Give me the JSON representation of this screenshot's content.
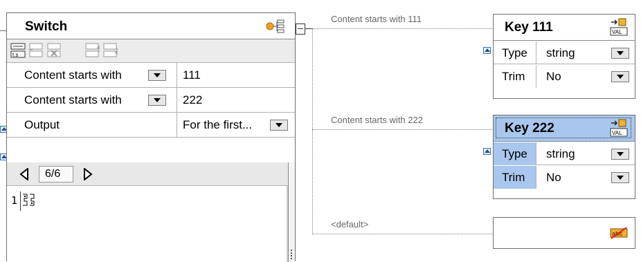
{
  "switch": {
    "title": "Switch",
    "conditions": [
      {
        "operator": "Content starts with",
        "value": "111"
      },
      {
        "operator": "Content starts with",
        "value": "222"
      }
    ],
    "output": {
      "label": "Output",
      "value": "For the first..."
    },
    "pager": {
      "text": "6/6"
    },
    "editor": {
      "line_number": "1"
    }
  },
  "connections": {
    "label_111": "Content starts with 111",
    "label_222": "Content starts with 222",
    "label_default": "<default>"
  },
  "keys": [
    {
      "title": "Key 111",
      "type_label": "Type",
      "type_value": "string",
      "trim_label": "Trim",
      "trim_value": "No"
    },
    {
      "title": "Key 222",
      "type_label": "Type",
      "type_value": "string",
      "trim_label": "Trim",
      "trim_value": "No"
    }
  ],
  "colors": {
    "selection": "#a9c7ee",
    "accent": "#f0a020"
  }
}
